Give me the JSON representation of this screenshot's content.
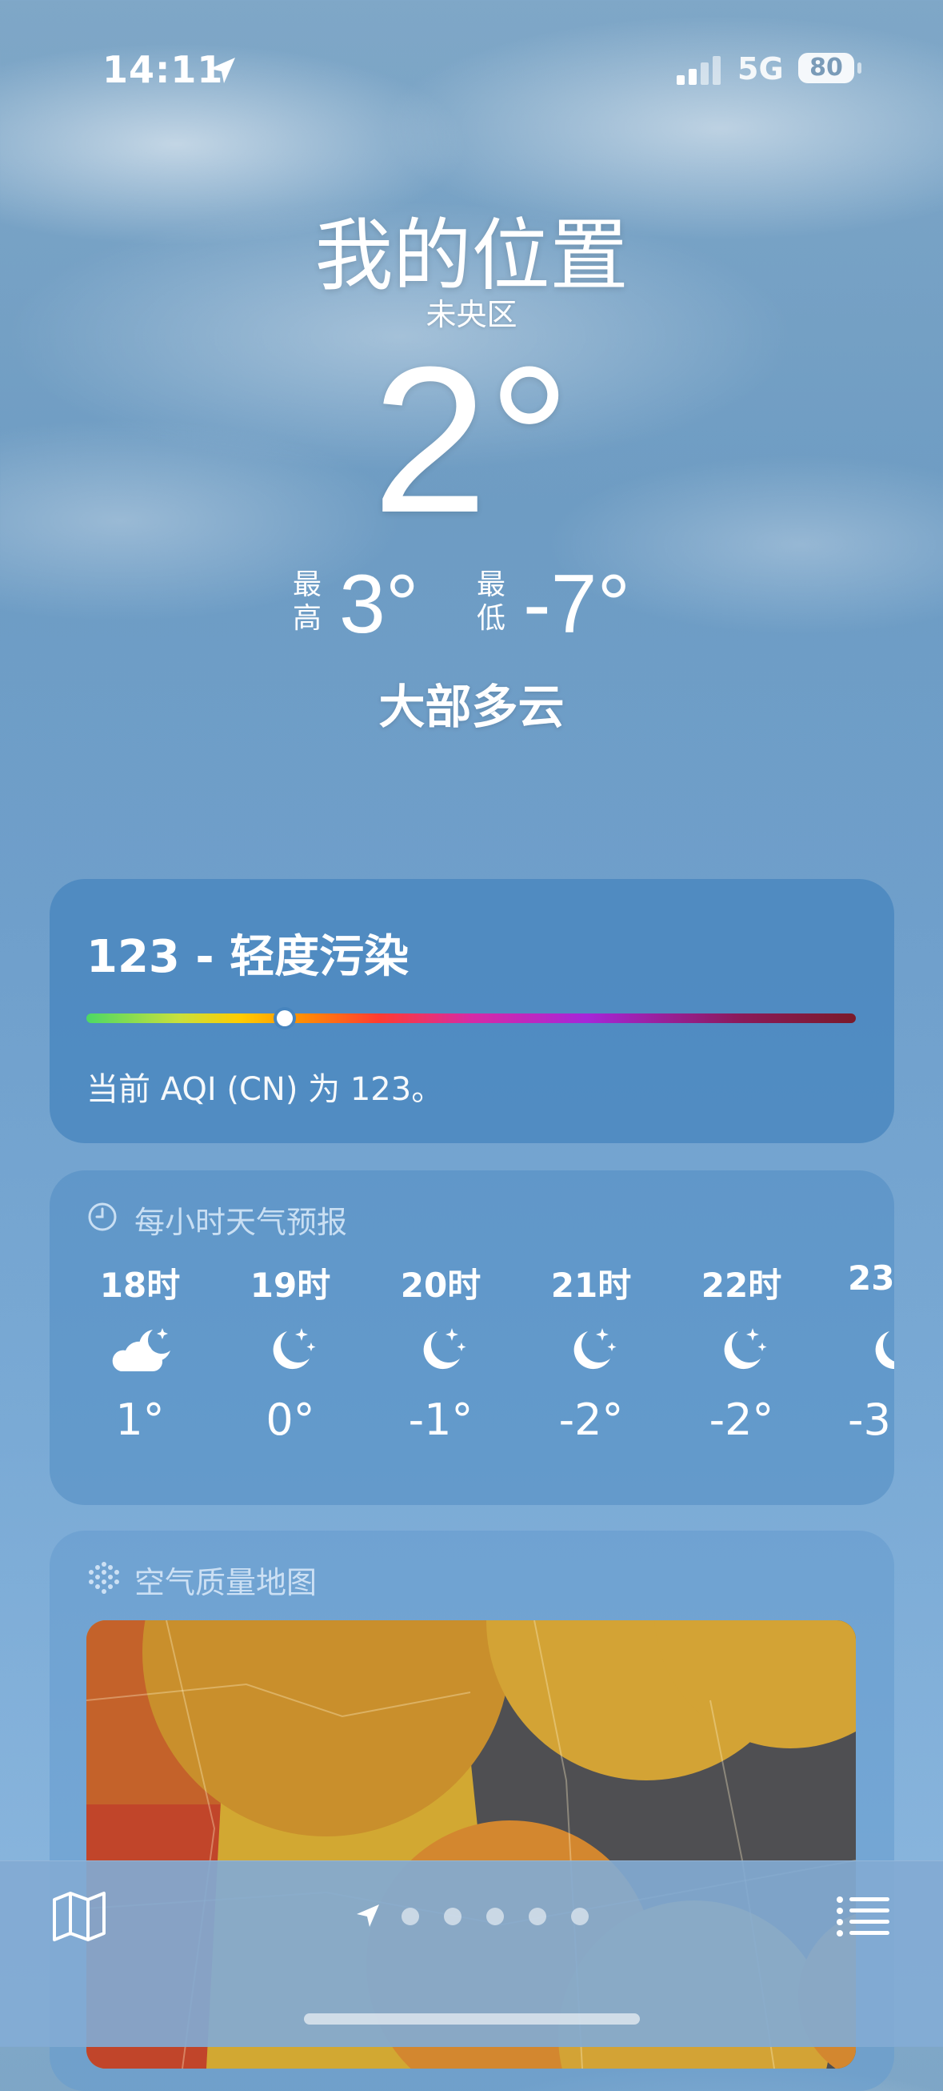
{
  "status_bar": {
    "time": "14:11",
    "network": "5G",
    "battery": "80"
  },
  "header": {
    "location": "我的位置",
    "district": "未央区",
    "temperature": "2°",
    "high_label": "最高",
    "high": "3°",
    "low_label": "最低",
    "low": "-7°",
    "condition": "大部多云"
  },
  "aqi": {
    "title": "123 - 轻度污染",
    "description": "当前 AQI (CN) 为 123。",
    "value": 123
  },
  "hourly": {
    "title": "每小时天气预报",
    "items": [
      {
        "hour": "18时",
        "icon": "cloud-moon-icon",
        "temp": "1°"
      },
      {
        "hour": "19时",
        "icon": "moon-stars-icon",
        "temp": "0°"
      },
      {
        "hour": "20时",
        "icon": "moon-stars-icon",
        "temp": "-1°"
      },
      {
        "hour": "21时",
        "icon": "moon-stars-icon",
        "temp": "-2°"
      },
      {
        "hour": "22时",
        "icon": "moon-stars-icon",
        "temp": "-2°"
      },
      {
        "hour": "23",
        "icon": "moon-stars-icon",
        "temp": "-3"
      }
    ]
  },
  "air_map": {
    "title": "空气质量地图"
  },
  "bottom_bar": {
    "page_count": 6,
    "current_page": 0
  }
}
